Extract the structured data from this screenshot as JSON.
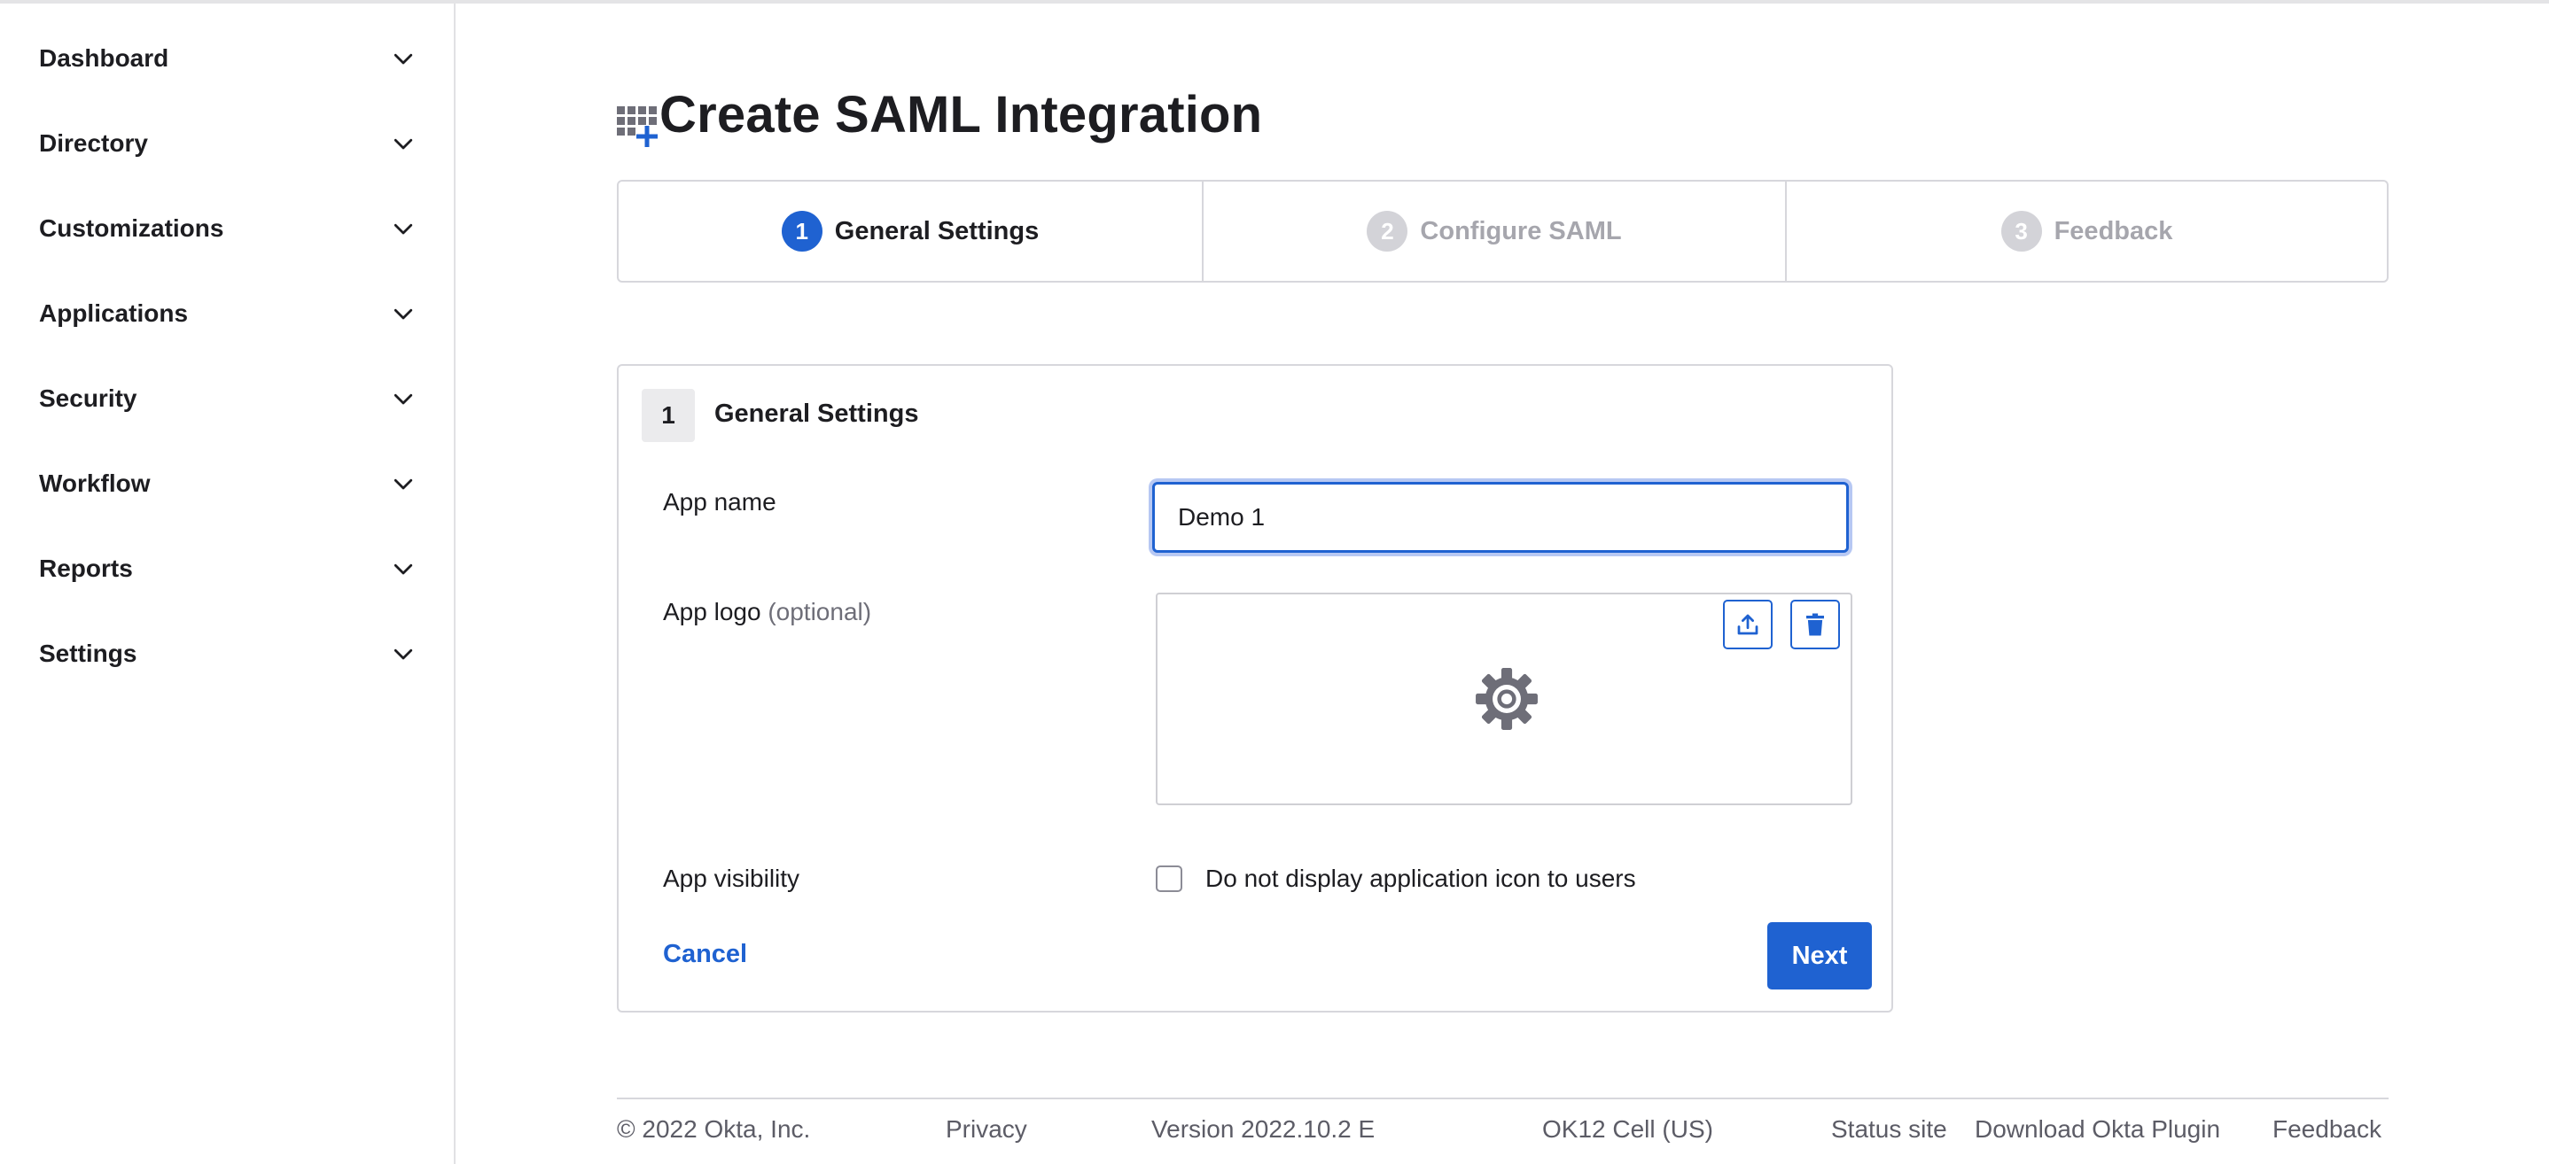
{
  "sidebar": {
    "items": [
      {
        "label": "Dashboard"
      },
      {
        "label": "Directory"
      },
      {
        "label": "Customizations"
      },
      {
        "label": "Applications"
      },
      {
        "label": "Security"
      },
      {
        "label": "Workflow"
      },
      {
        "label": "Reports"
      },
      {
        "label": "Settings"
      }
    ]
  },
  "page": {
    "title": "Create SAML Integration",
    "title_icon": "app-grid-add-icon"
  },
  "steps": [
    {
      "number": "1",
      "label": "General Settings",
      "state": "active"
    },
    {
      "number": "2",
      "label": "Configure SAML",
      "state": "inactive"
    },
    {
      "number": "3",
      "label": "Feedback",
      "state": "inactive"
    }
  ],
  "form": {
    "section_number": "1",
    "section_title": "General Settings",
    "app_name_label": "App name",
    "app_name_value": "Demo 1",
    "app_logo_label": "App logo",
    "app_logo_optional": "(optional)",
    "upload_icon": "upload-icon",
    "delete_icon": "trash-icon",
    "placeholder_logo_icon": "gear-icon",
    "app_visibility_label": "App visibility",
    "visibility_checkbox_label": "Do not display application icon to users",
    "visibility_checked": false,
    "cancel_label": "Cancel",
    "next_label": "Next"
  },
  "footer": {
    "copyright": "© 2022 Okta, Inc.",
    "privacy": "Privacy",
    "version": "Version 2022.10.2 E",
    "cell": "OK12 Cell (US)",
    "status_site": "Status site",
    "download_plugin": "Download Okta Plugin",
    "feedback": "Feedback"
  },
  "colors": {
    "accent": "#1f62d1",
    "inactive_step": "#d3d3d8",
    "border": "#d7d7dc"
  }
}
